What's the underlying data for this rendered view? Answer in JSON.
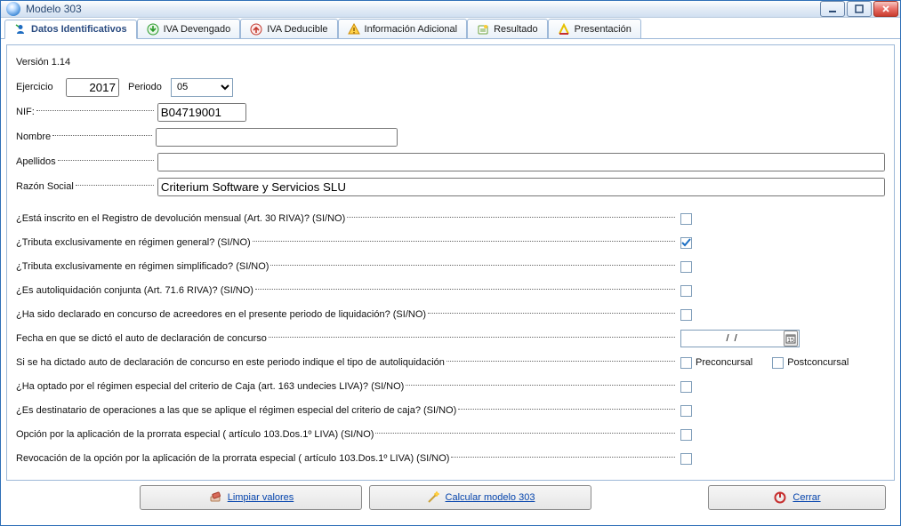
{
  "window": {
    "title": "Modelo 303"
  },
  "tabs": [
    {
      "label": "Datos Identificativos"
    },
    {
      "label": "IVA Devengado"
    },
    {
      "label": "IVA Deducible"
    },
    {
      "label": "Información Adicional"
    },
    {
      "label": "Resultado"
    },
    {
      "label": "Presentación"
    }
  ],
  "form": {
    "version": "Versión 1.14",
    "ejercicio_lbl": "Ejercicio",
    "ejercicio": "2017",
    "periodo_lbl": "Periodo",
    "periodo": "05",
    "nif_lbl": "NIF:",
    "nif": "B04719001",
    "nombre_lbl": "Nombre",
    "nombre": "",
    "apellidos_lbl": "Apellidos",
    "apellidos": "",
    "razon_lbl": "Razón Social",
    "razon": "Criterium Software y Servicios SLU",
    "questions": [
      {
        "text": "¿Está inscrito en el Registro de devolución mensual (Art. 30 RIVA)? (SI/NO)",
        "checked": false
      },
      {
        "text": "¿Tributa exclusivamente en régimen general? (SI/NO)",
        "checked": true
      },
      {
        "text": "¿Tributa exclusivamente en régimen simplificado? (SI/NO)",
        "checked": false
      },
      {
        "text": "¿Es autoliquidación conjunta (Art. 71.6 RIVA)? (SI/NO)",
        "checked": false
      },
      {
        "text": "¿Ha sido declarado en concurso de acreedores en el presente periodo de liquidación? (SI/NO)",
        "checked": false
      }
    ],
    "fecha_concurso_lbl": "Fecha en que se dictó el auto de declaración de concurso",
    "fecha_concurso": "/  /",
    "tipo_autoliq_lbl": "Si se ha dictado auto de declaración de concurso en este periodo indique el tipo de autoliquidación",
    "preconcursal_lbl": "Preconcursal",
    "postconcursal_lbl": "Postconcursal",
    "questions2": [
      {
        "text": "¿Ha optado por el régimen especial del criterio de Caja (art. 163 undecies LIVA)? (SI/NO)",
        "checked": false
      },
      {
        "text": "¿Es destinatario de operaciones a las que se aplique el régimen especial del criterio de caja? (SI/NO)",
        "checked": false
      },
      {
        "text": "Opción por la aplicación de la prorrata especial ( artículo 103.Dos.1º LIVA) (SI/NO)",
        "checked": false
      },
      {
        "text": "Revocación de la opción por la aplicación de la prorrata especial ( artículo 103.Dos.1º LIVA) (SI/NO)",
        "checked": false
      }
    ]
  },
  "footer": {
    "limpiar": "Limpiar valores",
    "calcular": "Calcular modelo 303",
    "cerrar": "Cerrar"
  }
}
